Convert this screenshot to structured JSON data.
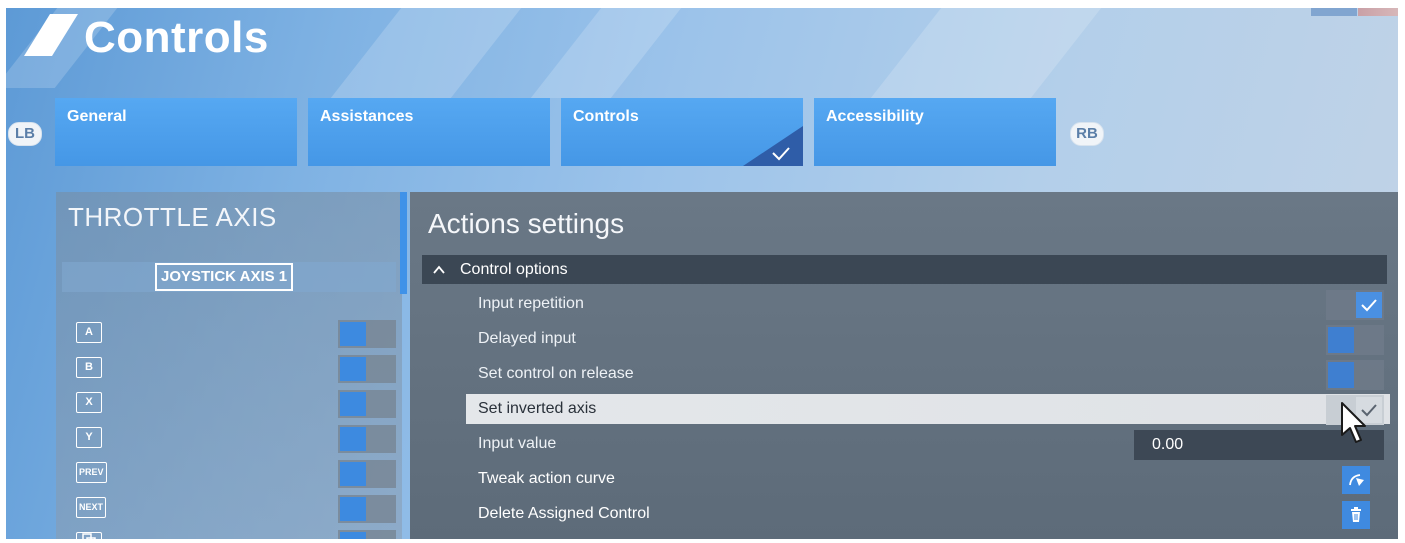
{
  "header": {
    "title": "Controls"
  },
  "bumpers": {
    "left": "LB",
    "right": "RB"
  },
  "tabs": [
    {
      "label": "General",
      "selected": false
    },
    {
      "label": "Assistances",
      "selected": false
    },
    {
      "label": "Controls",
      "selected": true
    },
    {
      "label": "Accessibility",
      "selected": false
    }
  ],
  "binding_panel": {
    "title": "THROTTLE AXIS",
    "bound_input": "JOYSTICK AXIS 1",
    "rows": [
      {
        "button": "A"
      },
      {
        "button": "B"
      },
      {
        "button": "X"
      },
      {
        "button": "Y"
      },
      {
        "button": "PREV"
      },
      {
        "button": "NEXT"
      },
      {
        "button": "view-icon"
      }
    ]
  },
  "actions": {
    "title": "Actions settings",
    "section": "Control options",
    "options": [
      {
        "label": "Input repetition",
        "type": "toggle",
        "checked": true
      },
      {
        "label": "Delayed input",
        "type": "toggle",
        "checked": false
      },
      {
        "label": "Set control on release",
        "type": "toggle",
        "checked": false
      },
      {
        "label": "Set inverted axis",
        "type": "toggle",
        "checked": true,
        "focused": true
      },
      {
        "label": "Input value",
        "type": "value",
        "value": "0.00"
      },
      {
        "label": "Tweak action curve",
        "type": "button",
        "icon": "curve-icon"
      },
      {
        "label": "Delete Assigned Control",
        "type": "button",
        "icon": "trash-icon"
      }
    ]
  },
  "colors": {
    "accent": "#4597e6",
    "panel_dark": "#3b4754"
  }
}
